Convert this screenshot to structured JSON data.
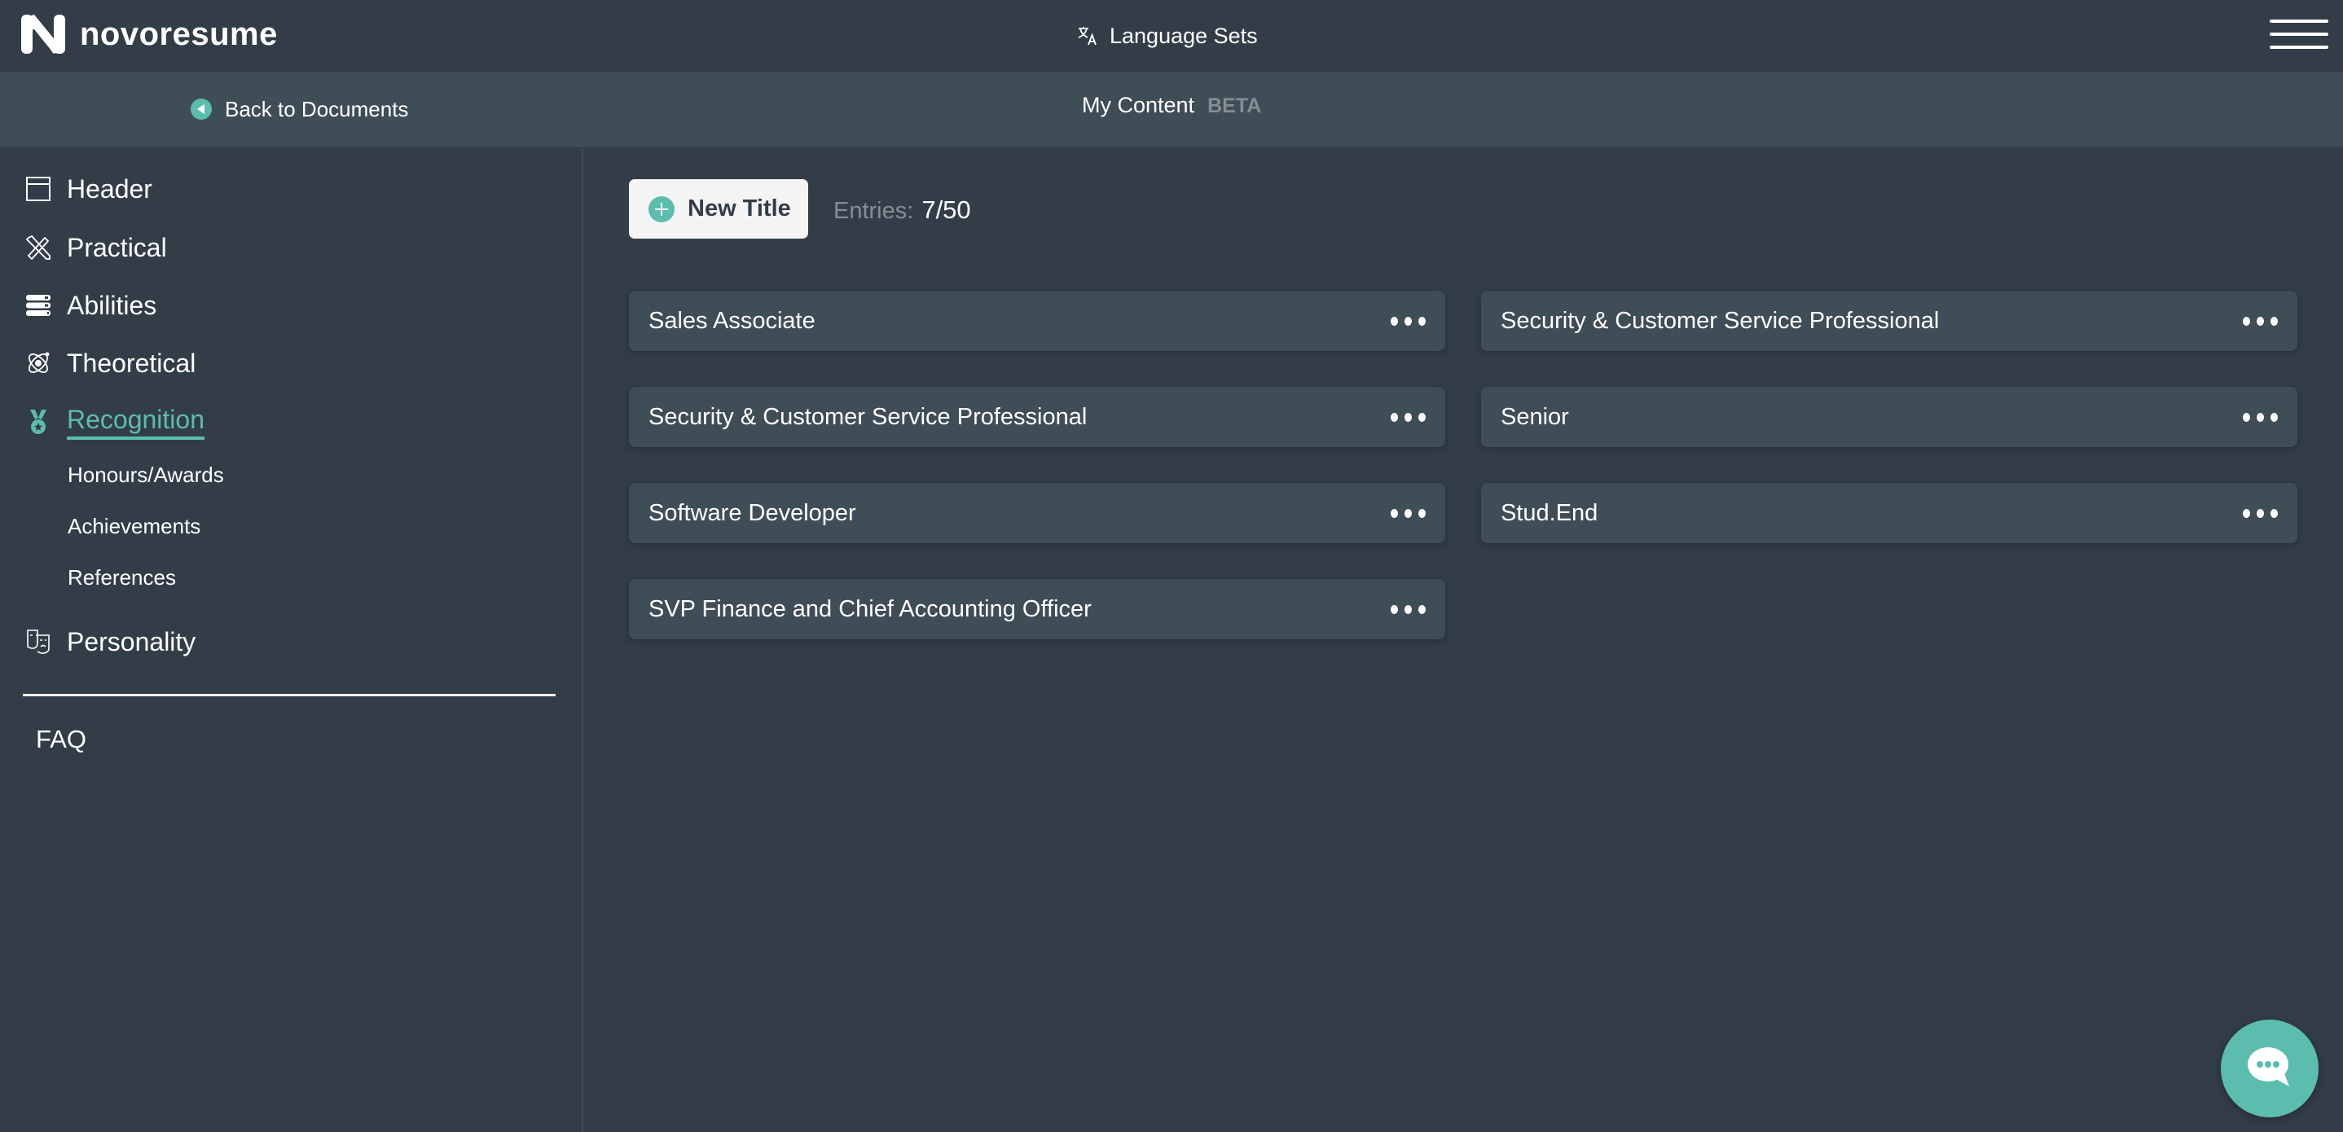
{
  "topbar": {
    "brand": "novoresume",
    "language_sets": "Language Sets"
  },
  "subbar": {
    "back_label": "Back to Documents",
    "title": "My Content",
    "badge": "BETA"
  },
  "sidebar": {
    "items": [
      {
        "label": "Header",
        "icon": "layout-icon"
      },
      {
        "label": "Practical",
        "icon": "pencil-ruler-icon"
      },
      {
        "label": "Abilities",
        "icon": "stacked-bars-icon"
      },
      {
        "label": "Theoretical",
        "icon": "atom-icon"
      },
      {
        "label": "Recognition",
        "icon": "medal-icon",
        "active": true
      },
      {
        "label": "Personality",
        "icon": "theater-masks-icon"
      }
    ],
    "sub_items": [
      "Honours/Awards",
      "Achievements",
      "References"
    ],
    "faq": "FAQ"
  },
  "toolbar": {
    "new_title_label": "New Title",
    "entries_label": "Entries:",
    "entries_value": "7/50"
  },
  "entries": [
    "Sales Associate",
    "Security & Customer Service Professional",
    "Security & Customer Service Professional",
    "Senior",
    "Software Developer",
    "Stud.End",
    "SVP Finance and Chief Accounting Officer"
  ],
  "colors": {
    "accent": "#5bbdae",
    "background": "#333d47",
    "surface": "#3f4d57",
    "muted": "#858e94"
  }
}
